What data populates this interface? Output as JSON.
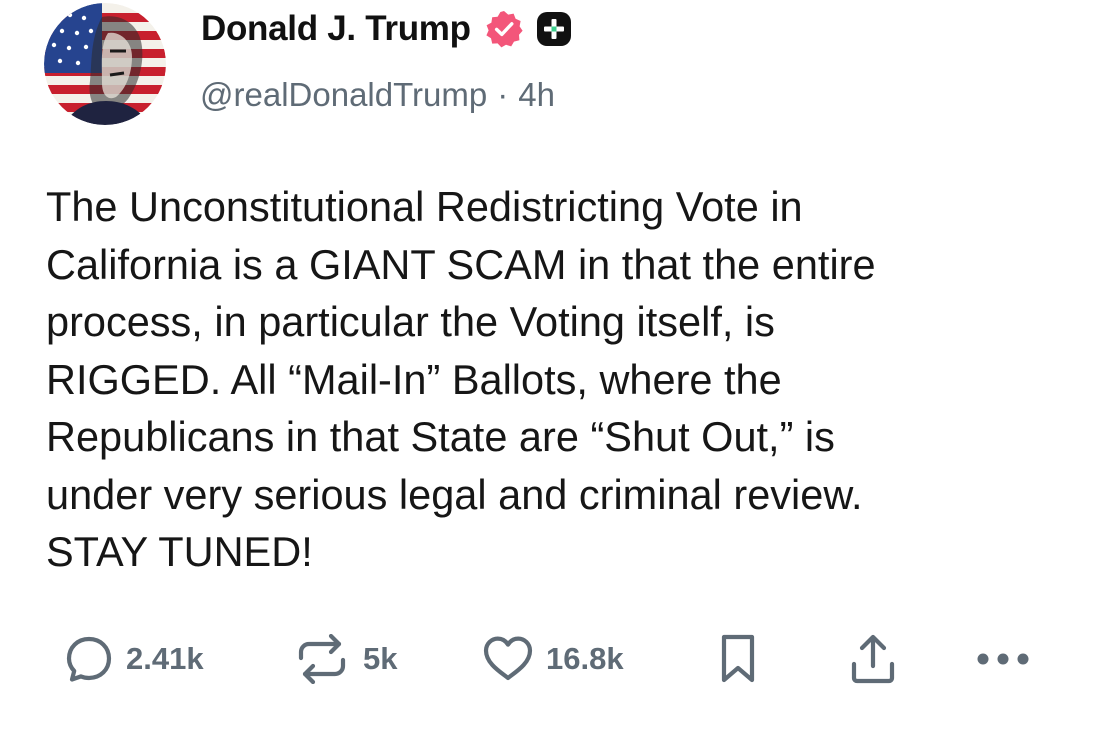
{
  "author": {
    "display_name": "Donald J. Trump",
    "handle": "@realDonaldTrump",
    "separator": "·",
    "time_ago": "4h",
    "avatar_icon": "flag-portrait-avatar",
    "verified_icon": "verified-badge-icon",
    "verified_color": "#f3567a",
    "plus_icon": "plus-badge-icon",
    "plus_color": "#111111"
  },
  "post": {
    "lines": [
      "The Unconstitutional Redistricting Vote in",
      "California is a GIANT SCAM in that the entire",
      "process, in particular the Voting itself, is",
      "RIGGED. All “Mail-In” Ballots, where the",
      "Republicans in that State are “Shut Out,” is",
      "under very serious legal and criminal review.",
      "STAY TUNED!"
    ]
  },
  "actions": {
    "reply": {
      "icon": "reply-bubble-icon",
      "count": "2.41k"
    },
    "repost": {
      "icon": "repost-icon",
      "count": "5k"
    },
    "like": {
      "icon": "heart-icon",
      "count": "16.8k"
    },
    "bookmark": {
      "icon": "bookmark-icon"
    },
    "share": {
      "icon": "share-upload-icon"
    },
    "more": {
      "icon": "more-dots-icon"
    }
  },
  "colors": {
    "text": "#161616",
    "secondary": "#5f6b76",
    "background": "#ffffff"
  }
}
